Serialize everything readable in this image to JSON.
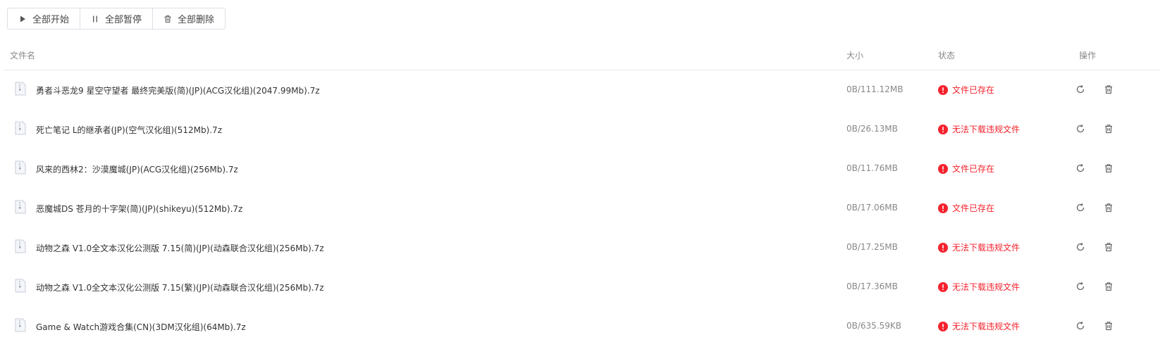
{
  "toolbar": {
    "start_all": "全部开始",
    "pause_all": "全部暂停",
    "delete_all": "全部删除"
  },
  "table": {
    "headers": {
      "name": "文件名",
      "size": "大小",
      "status": "状态",
      "ops": "操作"
    },
    "rows": [
      {
        "name": "勇者斗恶龙9 星空守望者 最终完美版(简)(JP)(ACG汉化组)(2047.99Mb).7z",
        "size": "0B/111.12MB",
        "status": "文件已存在"
      },
      {
        "name": "死亡笔记 L的继承者(JP)(空气汉化组)(512Mb).7z",
        "size": "0B/26.13MB",
        "status": "无法下载违规文件"
      },
      {
        "name": "风来的西林2：沙漠魔城(JP)(ACG汉化组)(256Mb).7z",
        "size": "0B/11.76MB",
        "status": "文件已存在"
      },
      {
        "name": "恶魔城DS 苍月的十字架(简)(JP)(shikeyu)(512Mb).7z",
        "size": "0B/17.06MB",
        "status": "文件已存在"
      },
      {
        "name": "动物之森 V1.0全文本汉化公测版 7.15(简)(JP)(动森联合汉化组)(256Mb).7z",
        "size": "0B/17.25MB",
        "status": "无法下载违规文件"
      },
      {
        "name": "动物之森 V1.0全文本汉化公测版 7.15(繁)(JP)(动森联合汉化组)(256Mb).7z",
        "size": "0B/17.36MB",
        "status": "无法下载违规文件"
      },
      {
        "name": "Game & Watch游戏合集(CN)(3DM汉化组)(64Mb).7z",
        "size": "0B/635.59KB",
        "status": "无法下载违规文件"
      }
    ]
  },
  "colors": {
    "error": "#f5222d",
    "muted": "#888888",
    "border": "#dcdfe6"
  },
  "icons": {
    "start": "play-icon",
    "pause": "pause-icon",
    "delete": "trash-icon",
    "file": "file-icon",
    "status": "exclamation-circle-icon",
    "retry": "refresh-icon"
  }
}
